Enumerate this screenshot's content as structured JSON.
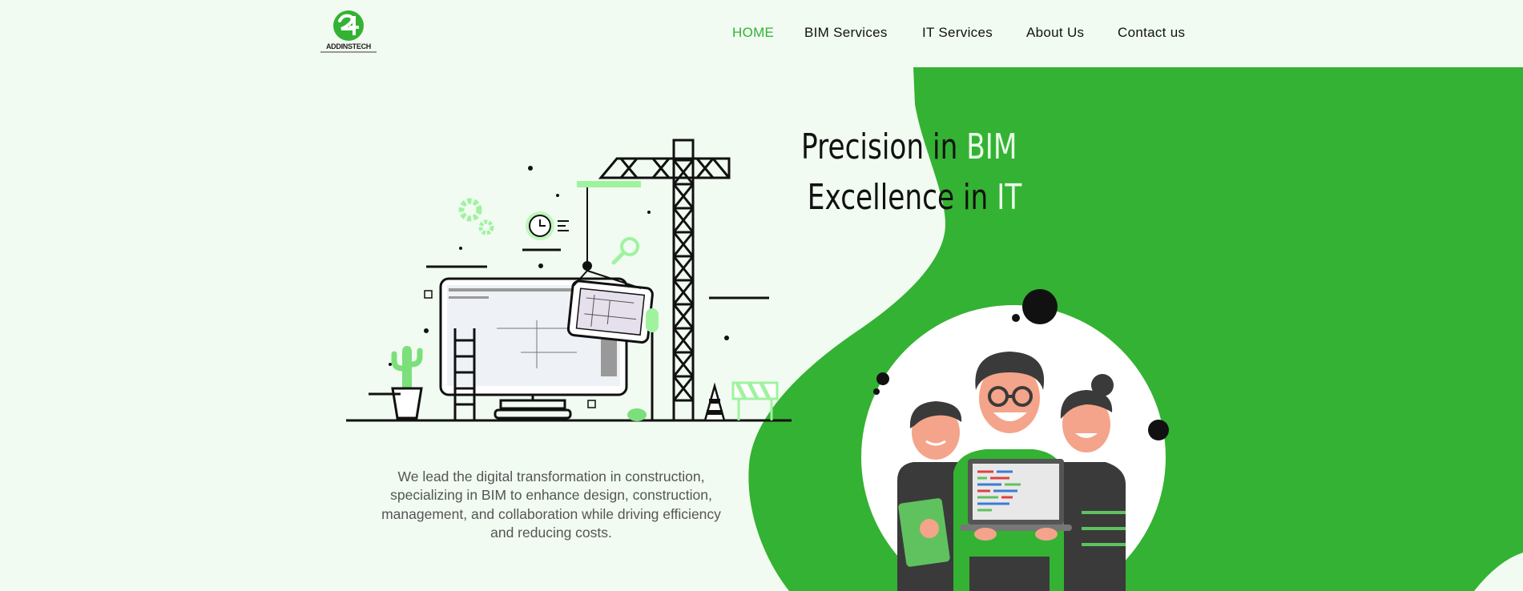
{
  "brand": {
    "name": "ADDINSTECH",
    "accent": "#34b233",
    "background": "#f1fbf1"
  },
  "nav": {
    "items": [
      {
        "label": "HOME",
        "active": true
      },
      {
        "label": "BIM Services",
        "active": false
      },
      {
        "label": "IT Services",
        "active": false
      },
      {
        "label": "About Us",
        "active": false
      },
      {
        "label": "Contact us",
        "active": false
      }
    ]
  },
  "hero": {
    "line1_prefix": "Precision in ",
    "line1_highlight": "BIM",
    "line2_prefix": "Excellence in ",
    "line2_highlight": "IT",
    "description": "We lead the digital transformation in construction, specializing in BIM to enhance design, construction, management, and collaboration while driving efficiency and reducing costs."
  },
  "icons": {
    "logo": "addinstech-logo-icon",
    "construction_illustration": "construction-crane-monitor-illustration",
    "team_illustration": "team-with-laptop-illustration"
  }
}
